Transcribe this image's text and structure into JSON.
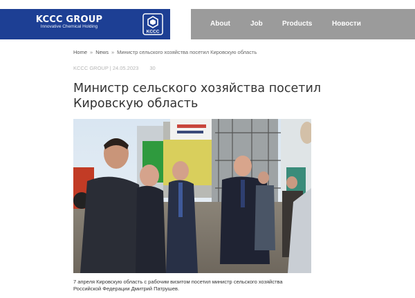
{
  "header": {
    "brand_name": "KCCC GROUP",
    "brand_tagline": "Innovative Chemical Holding",
    "logo_text": "KCCC",
    "nav": [
      {
        "label": "About"
      },
      {
        "label": "Job"
      },
      {
        "label": "Products"
      },
      {
        "label": "Новости"
      }
    ]
  },
  "breadcrumb": {
    "home": "Home",
    "sep": "»",
    "news": "News",
    "current": "Министр сельского хозяйства посетил Кировскую область"
  },
  "article": {
    "author_date": "KCCC GROUP | 24.05.2023",
    "views": "30",
    "title": "Министр сельского хозяйства посетил Кировскую область",
    "photo_alt": "news-photo",
    "caption": "7 апреля Кировскую область с рабочим визитом посетил министр сельского хозяйства Российской Федерации Дмитрий Патрушев."
  },
  "colors": {
    "brand_blue": "#1d3f94",
    "nav_gray": "#9b9b9b"
  }
}
